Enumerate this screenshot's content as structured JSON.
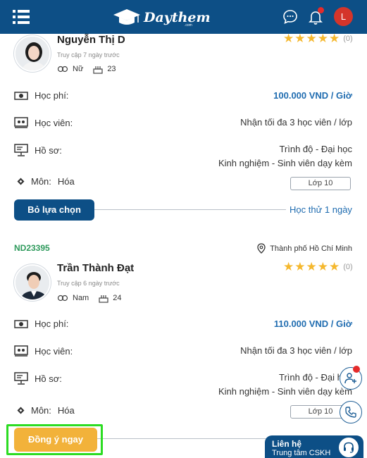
{
  "header": {
    "logo_text": "Daythem",
    "logo_sub": ".com",
    "user_initial": "L"
  },
  "tutors": [
    {
      "name": "Nguyễn Thị D",
      "last_access": "Truy cập 7 ngày trước",
      "gender": "Nữ",
      "age": "23",
      "rating_count": "(0)",
      "fee_label": "Học phí:",
      "fee_value": "100.000 VND / Giờ",
      "students_label": "Học viên:",
      "students_value": "Nhận tối đa 3 học viên / lớp",
      "profile_label": "Hồ sơ:",
      "profile_level": "Trình độ - Đại học",
      "profile_experience": "Kinh nghiệm - Sinh viên dạy kèm",
      "subject_label": "Môn:",
      "subject_value": "Hóa",
      "grade": "Lớp 10",
      "action_label": "Bỏ lựa chọn",
      "trial_label": "Học thử 1 ngày"
    },
    {
      "code": "ND23395",
      "location": "Thành phố Hồ Chí Minh",
      "name": "Trần Thành Đạt",
      "last_access": "Truy cập 6 ngày trước",
      "gender": "Nam",
      "age": "24",
      "rating_count": "(0)",
      "fee_label": "Học phí:",
      "fee_value": "110.000 VND / Giờ",
      "students_label": "Học viên:",
      "students_value": "Nhận tối đa 3 học viên / lớp",
      "profile_label": "Hồ sơ:",
      "profile_level": "Trình độ - Đại h",
      "profile_experience": "Kinh nghiệm - Sinh viên dạy kèm",
      "subject_label": "Môn:",
      "subject_value": "Hóa",
      "grade": "Lớp 10",
      "action_label": "Đồng ý ngay"
    }
  ],
  "contact": {
    "title": "Liên hệ",
    "subtitle": "Trung tâm CSKH"
  },
  "colors": {
    "brand": "#0d4f86",
    "accent": "#f2b23a",
    "star": "#f5b82e",
    "code_green": "#2e9a5c",
    "fee_blue": "#1f6cb0"
  }
}
